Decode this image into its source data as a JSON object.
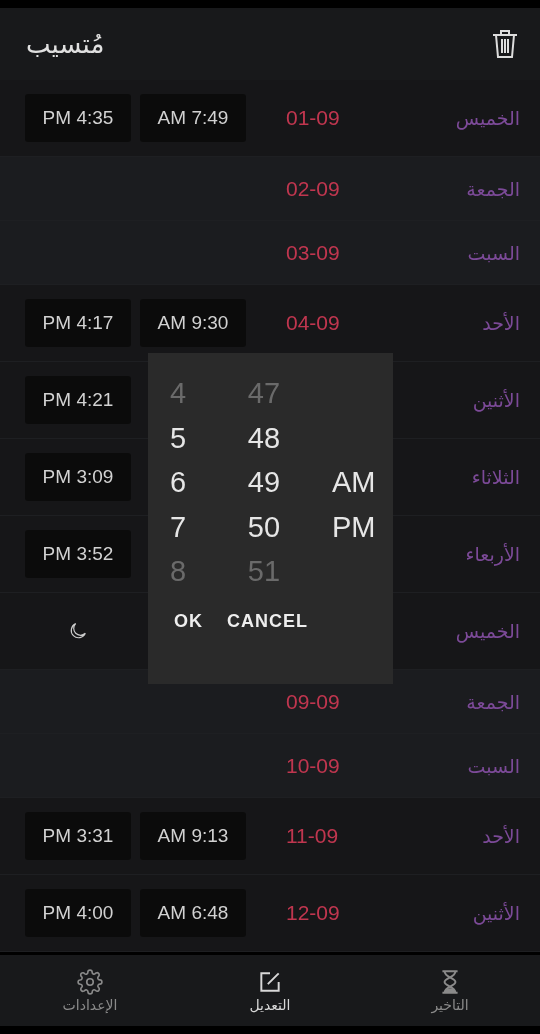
{
  "header": {
    "title": "مُتسيب"
  },
  "rows": [
    {
      "day": "الخميس",
      "date": "01-09",
      "weekend": false,
      "kind": "times",
      "times": [
        "AM 7:49",
        "PM 4:35"
      ]
    },
    {
      "day": "الجمعة",
      "date": "02-09",
      "weekend": true,
      "kind": "empty"
    },
    {
      "day": "السبت",
      "date": "03-09",
      "weekend": true,
      "kind": "empty"
    },
    {
      "day": "الأحد",
      "date": "04-09",
      "weekend": false,
      "kind": "times",
      "times": [
        "AM 9:30",
        "PM 4:17"
      ]
    },
    {
      "day": "الأثنين",
      "weekend": false,
      "kind": "times",
      "times": [
        "PM 4:21"
      ]
    },
    {
      "day": "الثلاثاء",
      "weekend": false,
      "kind": "times",
      "times": [
        "PM 3:09"
      ]
    },
    {
      "day": "الأربعاء",
      "weekend": false,
      "kind": "times",
      "times": [
        "PM 3:52"
      ]
    },
    {
      "day": "الخميس",
      "weekend": false,
      "kind": "off"
    },
    {
      "day": "الجمعة",
      "date": "09-09",
      "weekend": true,
      "kind": "empty"
    },
    {
      "day": "السبت",
      "date": "10-09",
      "weekend": true,
      "kind": "empty"
    },
    {
      "day": "الأحد",
      "date": "11-09",
      "weekend": false,
      "kind": "times",
      "times": [
        "AM 9:13",
        "PM 3:31"
      ]
    },
    {
      "day": "الأثنين",
      "date": "12-09",
      "weekend": false,
      "kind": "times",
      "times": [
        "AM 6:48",
        "PM 4:00"
      ]
    }
  ],
  "dialog": {
    "hours": [
      "4",
      "5",
      "6",
      "7",
      "8"
    ],
    "minutes": [
      "47",
      "48",
      "49",
      "50",
      "51"
    ],
    "periods": [
      "AM",
      "PM"
    ],
    "buttons": [
      "CANCEL",
      "OK"
    ]
  },
  "nav": [
    {
      "label": "التاخير",
      "selected": false
    },
    {
      "label": "التعديل",
      "selected": true
    },
    {
      "label": "الإعدادات",
      "selected": false
    }
  ]
}
